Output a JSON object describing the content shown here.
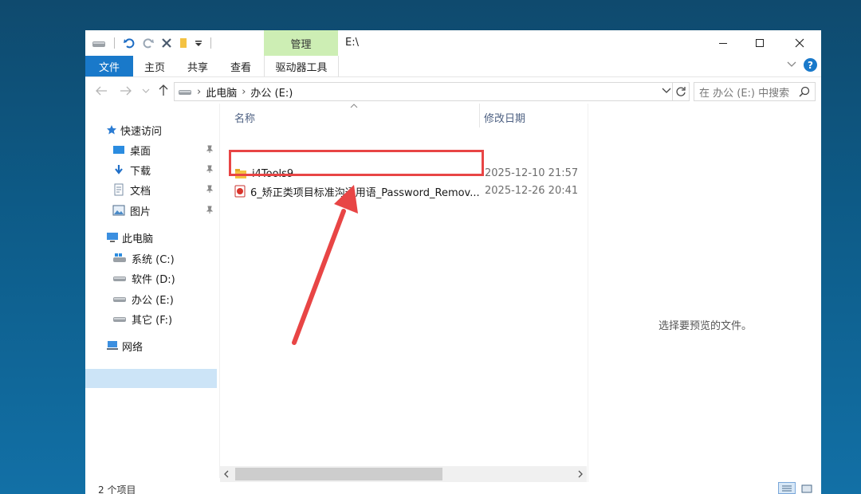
{
  "window": {
    "title": "E:\\",
    "context_tab_group": "管理",
    "minimize": "—",
    "maximize": "☐",
    "close": "✕"
  },
  "ribbon": {
    "tabs": [
      "文件",
      "主页",
      "共享",
      "查看",
      "驱动器工具"
    ],
    "help": "?"
  },
  "address_bar": {
    "path": [
      "此电脑",
      "办公 (E:)"
    ],
    "search_placeholder": "在 办公 (E:) 中搜索"
  },
  "sidebar": {
    "quick_access": "快速访问",
    "pinned": [
      "桌面",
      "下载",
      "文档",
      "图片"
    ],
    "this_pc": "此电脑",
    "drives": [
      "系统 (C:)",
      "软件 (D:)",
      "办公 (E:)",
      "其它 (F:)"
    ],
    "network": "网络",
    "selected": "办公 (E:)"
  },
  "file_list": {
    "columns": [
      "名称",
      "修改日期"
    ],
    "rows": [
      {
        "name": "i4Tools9",
        "date": "2025-12-10 21:57",
        "icon": "folder-icon"
      },
      {
        "name": "6_矫正类项目标准沟通用语_Password_Remov...",
        "date": "2025-12-26 20:41",
        "icon": "pdf-icon"
      }
    ]
  },
  "preview_pane": {
    "text": "选择要预览的文件。"
  },
  "status_bar": {
    "item_count": "2 个项目"
  },
  "colors": {
    "accent": "#1979ca",
    "context_tab": "#cdeeb4",
    "highlight": "#e84545",
    "selection": "#cce4f7"
  }
}
